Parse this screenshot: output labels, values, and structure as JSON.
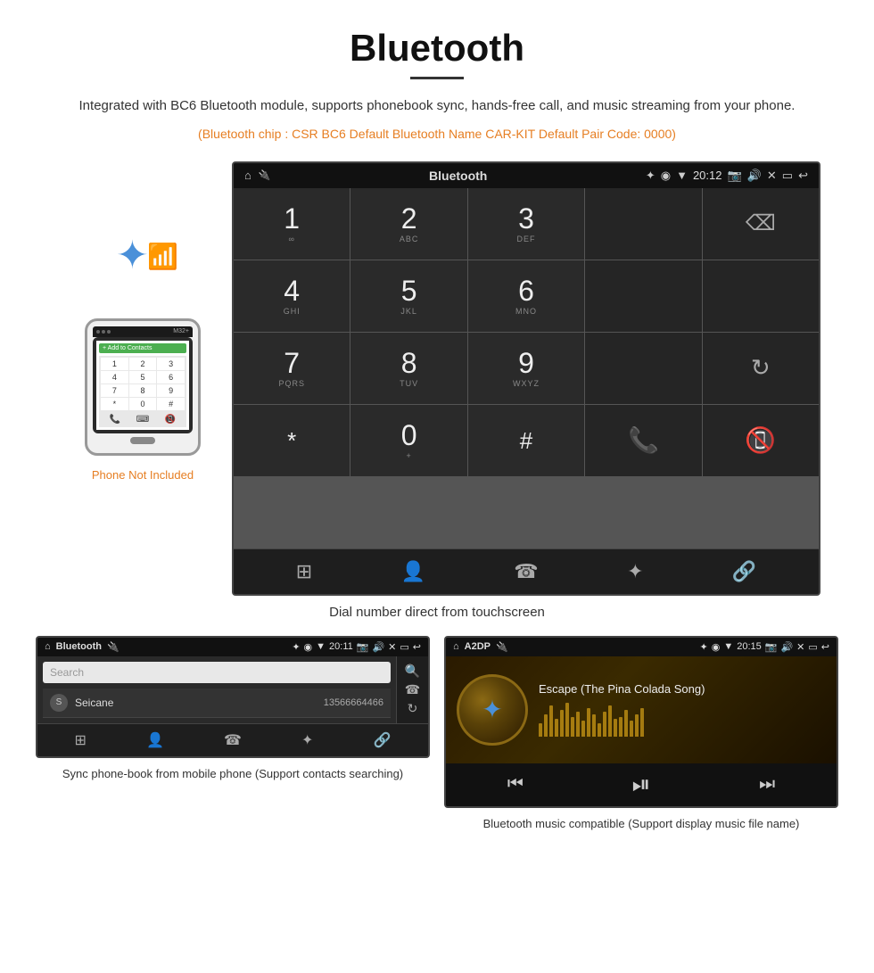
{
  "page": {
    "title": "Bluetooth",
    "subtitle": "Integrated with BC6 Bluetooth module, supports phonebook sync, hands-free call, and music streaming from your phone.",
    "orange_info": "(Bluetooth chip : CSR BC6    Default Bluetooth Name CAR-KIT    Default Pair Code: 0000)",
    "main_caption": "Dial number direct from touchscreen",
    "bottom_left_caption": "Sync phone-book from mobile phone\n(Support contacts searching)",
    "bottom_right_caption": "Bluetooth music compatible\n(Support display music file name)"
  },
  "main_screen": {
    "status_bar": {
      "title": "Bluetooth",
      "time": "20:12"
    },
    "dialpad": {
      "keys": [
        {
          "number": "1",
          "letters": "∞"
        },
        {
          "number": "2",
          "letters": "ABC"
        },
        {
          "number": "3",
          "letters": "DEF"
        },
        {
          "number": "",
          "letters": ""
        },
        {
          "number": "",
          "letters": "backspace"
        },
        {
          "number": "4",
          "letters": "GHI"
        },
        {
          "number": "5",
          "letters": "JKL"
        },
        {
          "number": "6",
          "letters": "MNO"
        },
        {
          "number": "",
          "letters": ""
        },
        {
          "number": "",
          "letters": ""
        },
        {
          "number": "7",
          "letters": "PQRS"
        },
        {
          "number": "8",
          "letters": "TUV"
        },
        {
          "number": "9",
          "letters": "WXYZ"
        },
        {
          "number": "",
          "letters": ""
        },
        {
          "number": "",
          "letters": "refresh"
        },
        {
          "number": "*",
          "letters": ""
        },
        {
          "number": "0",
          "letters": "+"
        },
        {
          "number": "#",
          "letters": ""
        },
        {
          "number": "",
          "letters": "call"
        },
        {
          "number": "",
          "letters": "end"
        }
      ]
    },
    "bottom_nav": [
      "grid",
      "person",
      "phone",
      "bluetooth",
      "link"
    ]
  },
  "phonebook_screen": {
    "status_bar": {
      "title": "Bluetooth",
      "time": "20:11"
    },
    "search_placeholder": "Search",
    "contacts": [
      {
        "letter": "S",
        "name": "Seicane",
        "number": "13566664466"
      }
    ]
  },
  "music_screen": {
    "status_bar": {
      "title": "A2DP",
      "time": "20:15"
    },
    "song_title": "Escape (The Pina Colada Song)",
    "eq_bars": [
      15,
      25,
      35,
      20,
      30,
      38,
      22,
      28,
      18,
      32,
      25,
      15,
      28,
      35,
      20,
      22,
      30,
      18,
      25,
      32
    ]
  },
  "phone": {
    "not_included": "Phone Not Included"
  },
  "icons": {
    "bluetooth": "✦",
    "home": "⌂",
    "back": "↩",
    "search": "🔍",
    "phone_call": "📞",
    "grid_menu": "⊞",
    "person": "👤",
    "link": "🔗",
    "prev": "⏮",
    "play_pause": "⏯",
    "next": "⏭"
  }
}
